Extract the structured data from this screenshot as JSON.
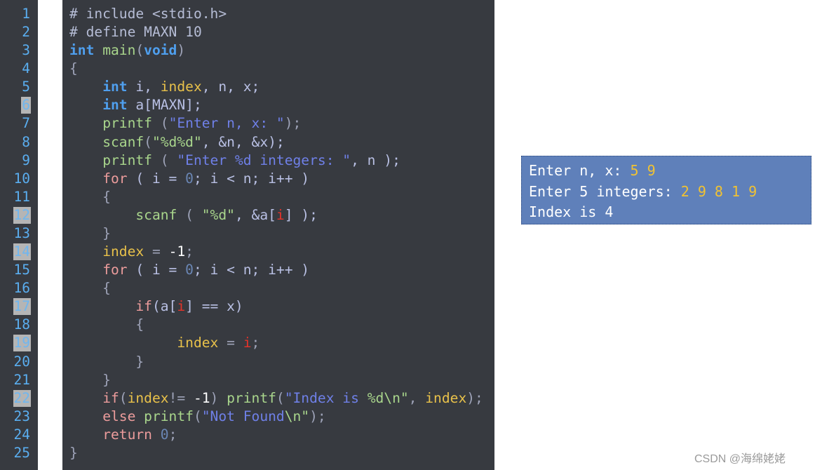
{
  "editor": {
    "lines": [
      {
        "number": "1",
        "highlighted": false,
        "tokens": [
          {
            "t": "# include <stdio.h>",
            "c": "p"
          }
        ]
      },
      {
        "number": "2",
        "highlighted": false,
        "tokens": [
          {
            "t": "# define MAXN 10",
            "c": "p"
          }
        ]
      },
      {
        "number": "3",
        "highlighted": false,
        "tokens": [
          {
            "t": "int",
            "c": "k"
          },
          {
            "t": " ",
            "c": "t"
          },
          {
            "t": "main",
            "c": "f"
          },
          {
            "t": "(",
            "c": "o"
          },
          {
            "t": "void",
            "c": "k"
          },
          {
            "t": ")",
            "c": "o"
          }
        ]
      },
      {
        "number": "4",
        "highlighted": false,
        "tokens": [
          {
            "t": "{",
            "c": "o"
          }
        ]
      },
      {
        "number": "5",
        "highlighted": false,
        "tokens": [
          {
            "t": "    ",
            "c": "t"
          },
          {
            "t": "int",
            "c": "k"
          },
          {
            "t": " i, ",
            "c": "t"
          },
          {
            "t": "index",
            "c": "v"
          },
          {
            "t": ", n, x;",
            "c": "t"
          }
        ]
      },
      {
        "number": "6",
        "highlighted": true,
        "tokens": [
          {
            "t": "    ",
            "c": "t"
          },
          {
            "t": "int",
            "c": "k"
          },
          {
            "t": " a[MAXN];",
            "c": "t"
          }
        ]
      },
      {
        "number": "7",
        "highlighted": false,
        "tokens": [
          {
            "t": "    ",
            "c": "t"
          },
          {
            "t": "printf",
            "c": "f"
          },
          {
            "t": " (",
            "c": "o"
          },
          {
            "t": "\"Enter n, x: \"",
            "c": "s"
          },
          {
            "t": ");",
            "c": "o"
          }
        ]
      },
      {
        "number": "8",
        "highlighted": false,
        "tokens": [
          {
            "t": "    ",
            "c": "t"
          },
          {
            "t": "scanf",
            "c": "f"
          },
          {
            "t": "(",
            "c": "o"
          },
          {
            "t": "\"%d%d\"",
            "c": "f"
          },
          {
            "t": ", &n, &x);",
            "c": "t"
          }
        ]
      },
      {
        "number": "9",
        "highlighted": false,
        "tokens": [
          {
            "t": "    ",
            "c": "t"
          },
          {
            "t": "printf",
            "c": "f"
          },
          {
            "t": " ( ",
            "c": "o"
          },
          {
            "t": "\"Enter %d integers: \"",
            "c": "s"
          },
          {
            "t": ", n );",
            "c": "t"
          }
        ]
      },
      {
        "number": "10",
        "highlighted": false,
        "tokens": [
          {
            "t": "    ",
            "c": "t"
          },
          {
            "t": "for",
            "c": "c"
          },
          {
            "t": " ( i = ",
            "c": "t"
          },
          {
            "t": "0",
            "c": "n"
          },
          {
            "t": "; i < n; i++ )",
            "c": "t"
          }
        ]
      },
      {
        "number": "11",
        "highlighted": false,
        "tokens": [
          {
            "t": "    {",
            "c": "o"
          }
        ]
      },
      {
        "number": "12",
        "highlighted": true,
        "tokens": [
          {
            "t": "        ",
            "c": "t"
          },
          {
            "t": "scanf",
            "c": "f"
          },
          {
            "t": " ( ",
            "c": "o"
          },
          {
            "t": "\"%d\"",
            "c": "f"
          },
          {
            "t": ", &a[",
            "c": "t"
          },
          {
            "t": "i",
            "c": "r"
          },
          {
            "t": "] );",
            "c": "t"
          }
        ]
      },
      {
        "number": "13",
        "highlighted": false,
        "tokens": [
          {
            "t": "    }",
            "c": "o"
          }
        ]
      },
      {
        "number": "14",
        "highlighted": true,
        "tokens": [
          {
            "t": "    ",
            "c": "t"
          },
          {
            "t": "index",
            "c": "v"
          },
          {
            "t": " = ",
            "c": "o"
          },
          {
            "t": "-1",
            "c": "w"
          },
          {
            "t": ";",
            "c": "o"
          }
        ]
      },
      {
        "number": "15",
        "highlighted": false,
        "tokens": [
          {
            "t": "    ",
            "c": "t"
          },
          {
            "t": "for",
            "c": "c"
          },
          {
            "t": " ( i = ",
            "c": "t"
          },
          {
            "t": "0",
            "c": "n"
          },
          {
            "t": "; i < n; i++ )",
            "c": "t"
          }
        ]
      },
      {
        "number": "16",
        "highlighted": false,
        "tokens": [
          {
            "t": "    {",
            "c": "o"
          }
        ]
      },
      {
        "number": "17",
        "highlighted": true,
        "tokens": [
          {
            "t": "        ",
            "c": "t"
          },
          {
            "t": "if",
            "c": "c"
          },
          {
            "t": "(a[",
            "c": "t"
          },
          {
            "t": "i",
            "c": "r"
          },
          {
            "t": "] == x)",
            "c": "t"
          }
        ]
      },
      {
        "number": "18",
        "highlighted": false,
        "tokens": [
          {
            "t": "        {",
            "c": "o"
          }
        ]
      },
      {
        "number": "19",
        "highlighted": true,
        "tokens": [
          {
            "t": "             ",
            "c": "t"
          },
          {
            "t": "index",
            "c": "v"
          },
          {
            "t": " = ",
            "c": "o"
          },
          {
            "t": "i",
            "c": "r"
          },
          {
            "t": ";",
            "c": "o"
          }
        ]
      },
      {
        "number": "20",
        "highlighted": false,
        "tokens": [
          {
            "t": "        }",
            "c": "o"
          }
        ]
      },
      {
        "number": "21",
        "highlighted": false,
        "tokens": [
          {
            "t": "    }",
            "c": "o"
          }
        ]
      },
      {
        "number": "22",
        "highlighted": true,
        "tokens": [
          {
            "t": "    ",
            "c": "t"
          },
          {
            "t": "if",
            "c": "c"
          },
          {
            "t": "(",
            "c": "o"
          },
          {
            "t": "index",
            "c": "v"
          },
          {
            "t": "!= ",
            "c": "o"
          },
          {
            "t": "-1",
            "c": "w"
          },
          {
            "t": ") ",
            "c": "o"
          },
          {
            "t": "printf",
            "c": "f"
          },
          {
            "t": "(",
            "c": "o"
          },
          {
            "t": "\"Index is ",
            "c": "s"
          },
          {
            "t": "%d\\n\"",
            "c": "f"
          },
          {
            "t": ", ",
            "c": "o"
          },
          {
            "t": "index",
            "c": "v"
          },
          {
            "t": ");",
            "c": "o"
          }
        ]
      },
      {
        "number": "23",
        "highlighted": false,
        "tokens": [
          {
            "t": "    ",
            "c": "t"
          },
          {
            "t": "else",
            "c": "c"
          },
          {
            "t": " ",
            "c": "t"
          },
          {
            "t": "printf",
            "c": "f"
          },
          {
            "t": "(",
            "c": "o"
          },
          {
            "t": "\"Not Found",
            "c": "s"
          },
          {
            "t": "\\n\"",
            "c": "f"
          },
          {
            "t": ");",
            "c": "o"
          }
        ]
      },
      {
        "number": "24",
        "highlighted": false,
        "tokens": [
          {
            "t": "    ",
            "c": "t"
          },
          {
            "t": "return",
            "c": "c"
          },
          {
            "t": " ",
            "c": "t"
          },
          {
            "t": "0",
            "c": "n"
          },
          {
            "t": ";",
            "c": "o"
          }
        ]
      },
      {
        "number": "25",
        "highlighted": false,
        "tokens": [
          {
            "t": "}",
            "c": "o"
          }
        ]
      }
    ]
  },
  "console": {
    "lines": [
      {
        "prompt": "Enter n, x: ",
        "input": "5 9"
      },
      {
        "prompt": "Enter 5 integers: ",
        "input": "2 9 8 1 9"
      },
      {
        "prompt": "Index is 4",
        "input": ""
      }
    ]
  },
  "watermark": "CSDN @海绵姥姥",
  "colors": {
    "editor_bg": "#373a40",
    "console_bg": "#5f80ba",
    "input_text": "#f1c232",
    "line_number": "#5aaef0"
  }
}
